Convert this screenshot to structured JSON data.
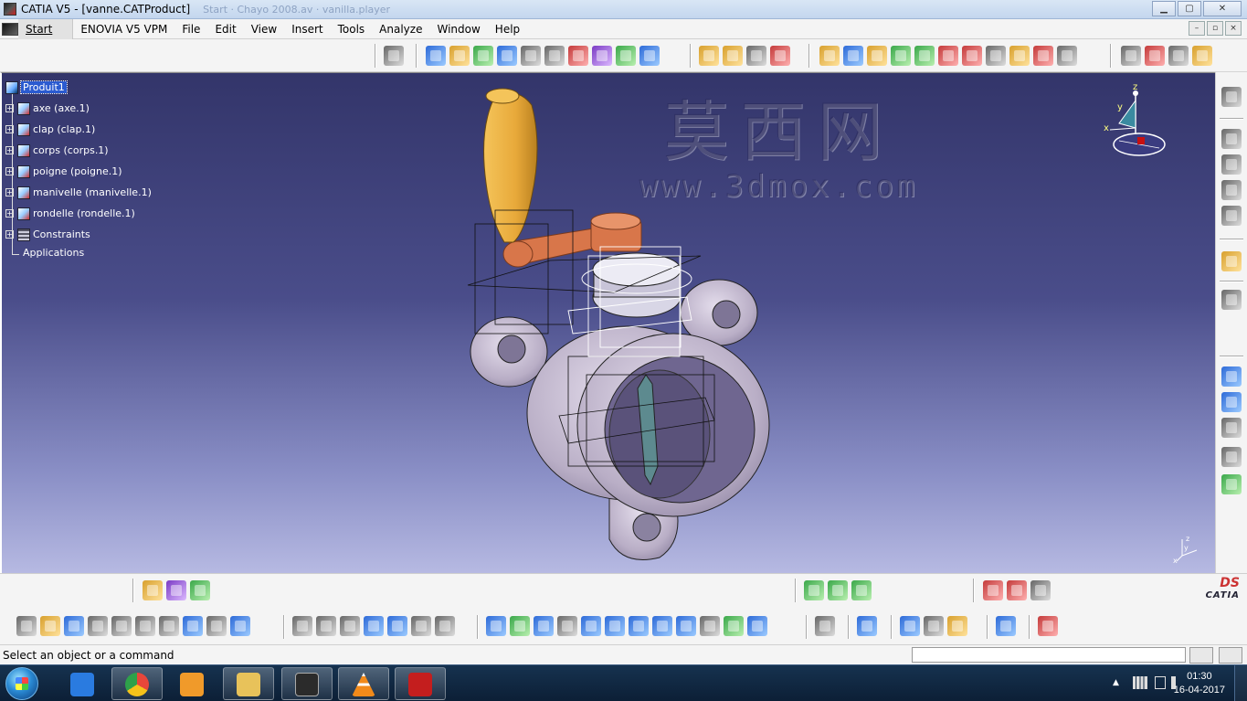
{
  "window": {
    "title": "CATIA V5 - [vanne.CATProduct]",
    "ghost_title": "Start · Chayo 2008.av · vanilla.player",
    "min": "▁",
    "max": "▢",
    "close": "✕"
  },
  "menu": {
    "items": [
      "Start",
      "ENOVIA V5 VPM",
      "File",
      "Edit",
      "View",
      "Insert",
      "Tools",
      "Analyze",
      "Window",
      "Help"
    ],
    "doc_min": "–",
    "doc_max": "▫",
    "doc_close": "×"
  },
  "tree": {
    "root": "Produit1",
    "items": [
      "axe (axe.1)",
      "clap (clap.1)",
      "corps (corps.1)",
      "poigne (poigne.1)",
      "manivelle (manivelle.1)",
      "rondelle (rondelle.1)",
      "Constraints"
    ],
    "applications": "Applications"
  },
  "watermark": {
    "chinese": "莫西网",
    "url": "www.3dmox.com"
  },
  "compass": {
    "x": "x",
    "y": "y",
    "z": "z"
  },
  "logo": {
    "ds": "DS",
    "name": "CATIA"
  },
  "status": {
    "message": "Select an object or a command",
    "command_value": ""
  },
  "taskbar": {
    "time": "01:30",
    "date": "16-04-2017",
    "tray_arrow": "▲",
    "apps": [
      {
        "icon": "internet-explorer-icon",
        "color": "#2a7be0"
      },
      {
        "icon": "chrome-icon",
        "color": "#e8463a"
      },
      {
        "icon": "media-player-icon",
        "color": "#f09a2a"
      },
      {
        "icon": "file-explorer-icon",
        "color": "#e8c25a"
      },
      {
        "icon": "catia-icon",
        "color": "#2b2b2b"
      },
      {
        "icon": "vlc-icon",
        "color": "#f28a1a"
      },
      {
        "icon": "acrobat-icon",
        "color": "#c41e1e"
      }
    ]
  },
  "colors": {
    "viewport_top": "#33356a",
    "viewport_bottom": "#b6b9e2",
    "handle": "#e8a93a",
    "crank": "#d8764a",
    "body": "#b9aec6",
    "selection": "#2b5bd0"
  }
}
